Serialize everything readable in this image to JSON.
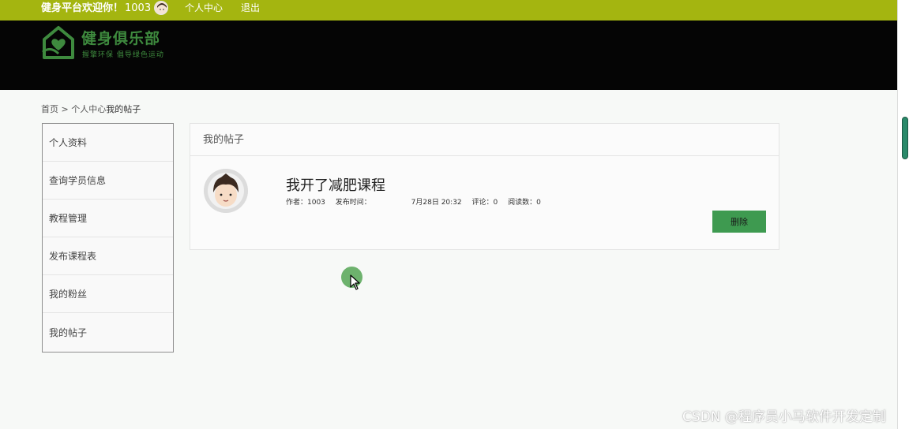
{
  "topbar": {
    "welcome": "健身平台欢迎你！",
    "user_id": "1003",
    "nav_profile": "个人中心",
    "nav_logout": "退出"
  },
  "logo": {
    "title": "健身俱乐部",
    "subtitle": "握擎环保  倡导绿色运动"
  },
  "breadcrumb": {
    "home": "首页",
    "sep": ">",
    "section": "个人中心",
    "current": "我的帖子"
  },
  "sidebar": {
    "items": [
      {
        "label": "个人资料"
      },
      {
        "label": "查询学员信息"
      },
      {
        "label": "教程管理"
      },
      {
        "label": "发布课程表"
      },
      {
        "label": "我的粉丝"
      },
      {
        "label": "我的帖子"
      }
    ]
  },
  "panel": {
    "title": "我的帖子",
    "post": {
      "title": "我开了减肥课程",
      "author": "作者：1003",
      "time_label": "发布时间：",
      "time_value": "7月28日 20:32",
      "comments": "评论：0",
      "reads": "阅读数：0",
      "delete_label": "删除"
    }
  },
  "watermark": "CSDN @程序员小马软件开发定制",
  "colors": {
    "topbar": "#a4b510",
    "header": "#050505",
    "brand_green": "#3e8a3e",
    "button_green": "#3e9a50"
  }
}
